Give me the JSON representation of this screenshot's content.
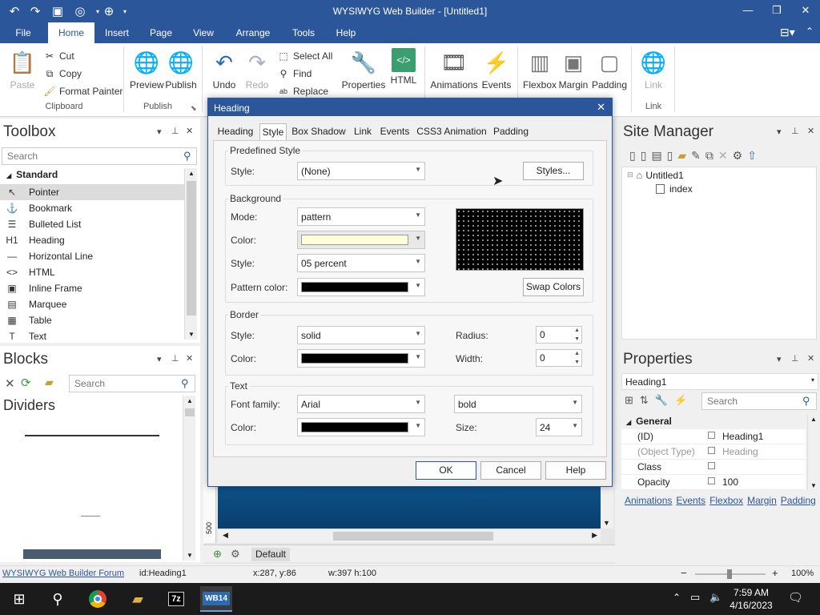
{
  "window": {
    "title": "WYSIWYG Web Builder - [Untitled1]"
  },
  "quick_access": [
    "undo-icon",
    "redo-icon",
    "save-icon",
    "preview-icon",
    "publish-icon"
  ],
  "ribbon_tabs": [
    "File",
    "Home",
    "Insert",
    "Page",
    "View",
    "Arrange",
    "Tools",
    "Help"
  ],
  "ribbon": {
    "clipboard": {
      "paste": "Paste",
      "cut": "Cut",
      "copy": "Copy",
      "format_painter": "Format Painter",
      "group": "Clipboard"
    },
    "publish": {
      "preview": "Preview",
      "publish": "Publish",
      "group": "Publish"
    },
    "edit": {
      "undo": "Undo",
      "redo": "Redo",
      "select_all": "Select All",
      "find": "Find",
      "replace": "Replace"
    },
    "properties": "Properties",
    "html": "HTML",
    "animations": "Animations",
    "events": "Events",
    "flexbox": "Flexbox",
    "margin": "Margin",
    "padding": "Padding",
    "link": "Link",
    "link_group": "Link"
  },
  "toolbox": {
    "title": "Toolbox",
    "search_placeholder": "Search",
    "section": "Standard",
    "items": [
      {
        "label": "Pointer",
        "icon": "pointer-icon",
        "glyph": "↖"
      },
      {
        "label": "Bookmark",
        "icon": "anchor-icon",
        "glyph": "⚓"
      },
      {
        "label": "Bulleted List",
        "icon": "list-icon",
        "glyph": "☰"
      },
      {
        "label": "Heading",
        "icon": "heading-icon",
        "glyph": "H1"
      },
      {
        "label": "Horizontal Line",
        "icon": "line-icon",
        "glyph": "—"
      },
      {
        "label": "HTML",
        "icon": "code-icon",
        "glyph": "<>"
      },
      {
        "label": "Inline Frame",
        "icon": "frame-icon",
        "glyph": "▣"
      },
      {
        "label": "Marquee",
        "icon": "marquee-icon",
        "glyph": "▤"
      },
      {
        "label": "Table",
        "icon": "table-icon",
        "glyph": "▦"
      },
      {
        "label": "Text",
        "icon": "text-icon",
        "glyph": "T"
      }
    ]
  },
  "blocks": {
    "title": "Blocks",
    "search_placeholder": "Search",
    "category": "Dividers"
  },
  "canvas": {
    "ruler_value": "500",
    "page_tab": "Default"
  },
  "dialog": {
    "title": "Heading",
    "tabs": [
      "Heading",
      "Style",
      "Box Shadow",
      "Link",
      "Events",
      "CSS3 Animation",
      "Padding"
    ],
    "predefined": {
      "group": "Predefined Style",
      "style_label": "Style:",
      "style_value": "(None)",
      "styles_button": "Styles..."
    },
    "background": {
      "group": "Background",
      "mode_label": "Mode:",
      "mode_value": "pattern",
      "color_label": "Color:",
      "color_value": "#ffffd8",
      "style_label": "Style:",
      "style_value": "05 percent",
      "pattern_color_label": "Pattern color:",
      "pattern_color_value": "#000000",
      "swap_button": "Swap Colors"
    },
    "border": {
      "group": "Border",
      "style_label": "Style:",
      "style_value": "solid",
      "color_label": "Color:",
      "color_value": "#000000",
      "radius_label": "Radius:",
      "radius_value": "0",
      "width_label": "Width:",
      "width_value": "0"
    },
    "text": {
      "group": "Text",
      "font_label": "Font family:",
      "font_value": "Arial",
      "weight_value": "bold",
      "color_label": "Color:",
      "color_value": "#000000",
      "size_label": "Size:",
      "size_value": "24"
    },
    "ok": "OK",
    "cancel": "Cancel",
    "help": "Help"
  },
  "site_manager": {
    "title": "Site Manager",
    "root": "Untitled1",
    "page": "index"
  },
  "properties": {
    "title": "Properties",
    "object": "Heading1",
    "search_placeholder": "Search",
    "section": "General",
    "rows": [
      {
        "key": "(ID)",
        "value": "Heading1",
        "dim": false
      },
      {
        "key": "(Object Type)",
        "value": "Heading",
        "dim": true
      },
      {
        "key": "Class",
        "value": "",
        "dim": false
      },
      {
        "key": "Opacity",
        "value": "100",
        "dim": false
      }
    ],
    "links": [
      "Animations",
      "Events",
      "Flexbox",
      "Margin",
      "Padding"
    ]
  },
  "status": {
    "forum": "WYSIWYG Web Builder Forum",
    "id": "id:Heading1",
    "coords": "x:287, y:86",
    "size": "w:397 h:100",
    "zoom": "100%"
  },
  "taskbar": {
    "time": "7:59 AM",
    "date": "4/16/2023"
  },
  "colors": {
    "accent": "#2b579a"
  }
}
